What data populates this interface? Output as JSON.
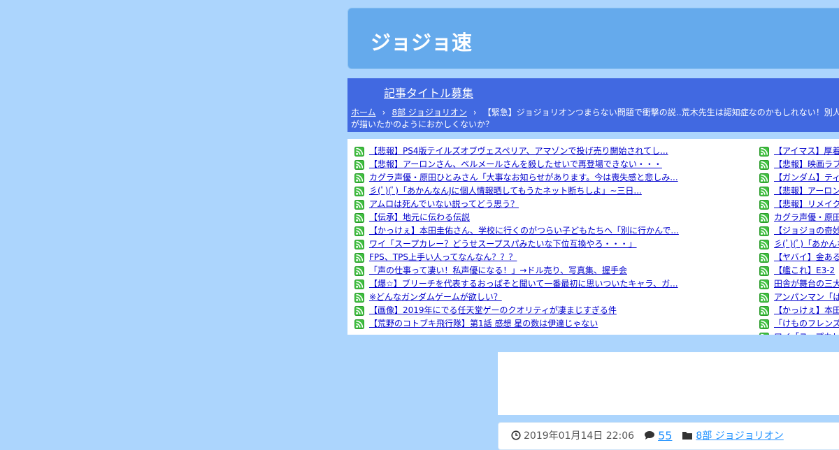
{
  "site": {
    "title": "ジョジョ速"
  },
  "nav": {
    "link_label": "記事タイトル募集"
  },
  "breadcrumb": {
    "home": "ホーム",
    "category": "8部 ジョジョリオン",
    "current": "【緊急】ジョジョリオンつまらない問題で衝撃の説‥荒木先生は認知症なのかもしれない！別人が描いたかのようにおかしくないか？"
  },
  "rss": {
    "left": [
      "【悲報】PS4版テイルズオブヴェスペリア、アマゾンで投げ売り開始されてし...",
      "【悲報】アーロンさん、ベルメールさんを殺したせいで再登場できない・・・",
      "カグラ声優・原田ひとみさん「大事なお知らせがあります。今は喪失感と悲しみ...",
      "彡(ﾟ)(ﾟ)「あかんなんJに個人情報晒してもうたネット断ちしよ」~三日...",
      "アムロは死んでいない説ってどう思う？",
      "【伝承】地元に伝わる伝説",
      "【かっけぇ】本田圭佑さん、学校に行くのがつらい子どもたちへ「別に行かんで...",
      "ワイ「スープカレー？どうせスープスパみたいな下位互換やろ・・・」",
      "FPS、TPS上手い人ってなんなん？？？",
      "「声の仕事って凄い！私声優になる！」→ドル売り、写真集、握手会",
      "【爆☆】ブリーチを代表するおっぱそと聞いて一番最初に思いついたキャラ、ガ...",
      "※どんなガンダムゲームが欲しい？",
      "【画像】2019年にでる任天堂ゲーのクオリティが凄まじすぎる件",
      "【荒野のコトブキ飛行隊】第1話 感想 星の数は伊達じゃない"
    ],
    "right": [
      "【アイマス】厚着",
      "【悲報】映画ラブ",
      "【ガンダム】ティ",
      "【悲報】アーロン",
      "【悲報】リメイク",
      "カグラ声優・原田",
      "【ジョジョの奇妙",
      "彡(ﾟ)(ﾟ)「あかんな",
      "【ヤバイ】金ある",
      "【艦これ】E3-2",
      "田舎が舞台の三大",
      "アンパンマン「は",
      "【かっけぇ】本田",
      "「けものフレンズ",
      "ワイ「スープカレ"
    ]
  },
  "post": {
    "date": "2019年01月14日 22:06",
    "comments": "55",
    "category": "8部 ジョジョリオン"
  },
  "colors": {
    "page_bg": "#acd5fd",
    "header_bg": "#65aaec",
    "nav_bg": "#4169e1",
    "rss_orange": "#ff8c00",
    "link_blue": "#0000cc"
  },
  "icons": {
    "rss": "rss-feed-icon",
    "clock": "clock-icon",
    "comment": "comment-icon",
    "folder": "folder-icon",
    "chevron": "chevron-right-icon"
  }
}
